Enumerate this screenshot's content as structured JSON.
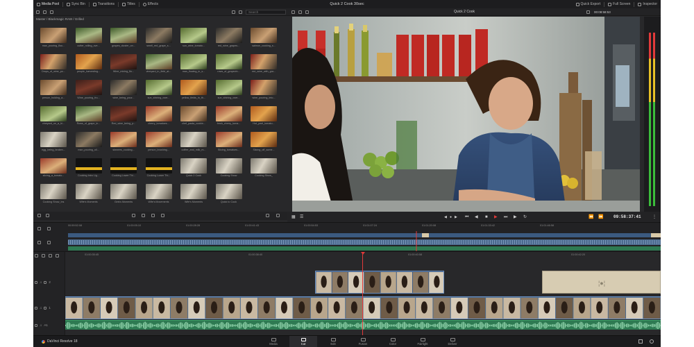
{
  "topbar": {
    "tabs": [
      {
        "label": "Media Pool",
        "icon": "media-pool-icon"
      },
      {
        "label": "Sync Bin",
        "icon": "sync-bin-icon"
      },
      {
        "label": "Transitions",
        "icon": "transitions-icon"
      },
      {
        "label": "Titles",
        "icon": "titles-icon"
      },
      {
        "label": "Effects",
        "icon": "effects-icon"
      }
    ],
    "project_title": "Quick 2 Cook 30sec",
    "right_buttons": [
      {
        "label": "Quick Export",
        "icon": "export-icon"
      },
      {
        "label": "Full Screen",
        "icon": "fullscreen-icon"
      },
      {
        "label": "Inspector",
        "icon": "inspector-icon"
      }
    ]
  },
  "subbar": {
    "search_placeholder": "Search",
    "viewer_name": "Quick 2 Cook",
    "viewer_timecode": "00:08:58:53"
  },
  "media_pool": {
    "breadcrumb": "Master / Blackmagic RAW / Grilled",
    "clips": [
      {
        "name": "man_pouring_flou...",
        "thumb": "t0"
      },
      {
        "name": "cutter_rolling_ove...",
        "thumb": "t1"
      },
      {
        "name": "grapes_cluster_on...",
        "thumb": "t1"
      },
      {
        "name": "smell_red_grape_s...",
        "thumb": "t3"
      },
      {
        "name": "sun_wine_tomato...",
        "thumb": "t4"
      },
      {
        "name": "red_wine_grapes...",
        "thumb": "t3"
      },
      {
        "name": "salmon_cooking_s...",
        "thumb": "t0"
      },
      {
        "name": "Drops_of_wine_po...",
        "thumb": "t2"
      },
      {
        "name": "people_harvesting...",
        "thumb": "t5"
      },
      {
        "name": "Wine_mixing_flo...",
        "thumb": "t6"
      },
      {
        "name": "vineyard_in_field_at...",
        "thumb": "t1"
      },
      {
        "name": "man_flowing_in_s...",
        "thumb": "t4"
      },
      {
        "name": "rows_of_grapevin...",
        "thumb": "t4"
      },
      {
        "name": "red_wine_with_gra...",
        "thumb": "t2"
      },
      {
        "name": "person_holding_a...",
        "thumb": "t0"
      },
      {
        "name": "Wine_pouring_fro...",
        "thumb": "t6"
      },
      {
        "name": "wine_being_pour...",
        "thumb": "t3"
      },
      {
        "name": "sun_shining_over...",
        "thumb": "t4"
      },
      {
        "name": "yellow_fields_in_th...",
        "thumb": "t5"
      },
      {
        "name": "sun_shining_over...",
        "thumb": "t4"
      },
      {
        "name": "wine_pouring_into...",
        "thumb": "t2"
      },
      {
        "name": "vineyard_on_a_hi...",
        "thumb": "t4"
      },
      {
        "name": "Rows_of_grape_in...",
        "thumb": "t1"
      },
      {
        "name": "Red_wine_being_p...",
        "thumb": "t6"
      },
      {
        "name": "cherry_tomatoes...",
        "thumb": "t8"
      },
      {
        "name": "chef_pasta_cookin...",
        "thumb": "t0"
      },
      {
        "name": "fresh_cherry_toma...",
        "thumb": "t8"
      },
      {
        "name": "Hot_peel_tomato...",
        "thumb": "t5"
      },
      {
        "name": "egg_being_broken...",
        "thumb": "t7"
      },
      {
        "name": "man_pouring_oil...",
        "thumb": "t3"
      },
      {
        "name": "skewers_cooking...",
        "thumb": "t8"
      },
      {
        "name": "person_brushing...",
        "thumb": "t8"
      },
      {
        "name": "coffee_and_milk_m...",
        "thumb": "t7"
      },
      {
        "name": "Slicing_tomatoes...",
        "thumb": "t8"
      },
      {
        "name": "Slicing_off_some...",
        "thumb": "t5"
      },
      {
        "name": "slicing_a_tomato...",
        "thumb": "t8"
      },
      {
        "name": "Cooking Intro Lig...",
        "thumb": "tyel"
      },
      {
        "name": "Cooking Lower Thi...",
        "thumb": "tyel"
      },
      {
        "name": "Cooking Lower Thi...",
        "thumb": "tyel"
      },
      {
        "name": "Quick 2 Cook",
        "thumb": "t7"
      },
      {
        "name": "Cooking Show",
        "thumb": "t7"
      },
      {
        "name": "Cooking Show_",
        "thumb": "t7"
      },
      {
        "name": "Cooking Show_Ins",
        "thumb": "t7"
      },
      {
        "name": "Wife's Moments",
        "thumb": "t7"
      },
      {
        "name": "Girls's Moments",
        "thumb": "t7"
      },
      {
        "name": "Wife's Movements",
        "thumb": "t7"
      },
      {
        "name": "Wife's Moments",
        "thumb": "t7"
      },
      {
        "name": "Quick to Cook",
        "thumb": "t7"
      }
    ]
  },
  "viewer": {
    "timecode": "09:58:37:41",
    "controls": [
      "skip-start",
      "step-back",
      "stop",
      "play",
      "step-forward",
      "skip-end",
      "loop"
    ]
  },
  "colors": {
    "accent_red": "#e23a3a",
    "video_clip_blue": "#4b6a8e",
    "audio_clip_green": "#2e7a52",
    "panel_bg": "#28282a"
  },
  "upper_timeline": {
    "ruler": [
      "00:59:52:08",
      "01:00:05:10",
      "01:00:28:28",
      "01:00:41:43",
      "01:00:54:53",
      "01:01:07:24",
      "01:01:20:08",
      "01:01:33:42",
      "01:01:46:58"
    ]
  },
  "lower_timeline": {
    "ruler": [
      "01:00:35:45",
      "01:00:38:40",
      "01:00:40:58",
      "01:00:42:20"
    ],
    "tracks": [
      {
        "label": "2"
      },
      {
        "label": "1"
      },
      {
        "label": "A1"
      }
    ]
  },
  "pagebar": {
    "brand": "DaVinci Resolve 18",
    "pages": [
      {
        "label": "Media",
        "active": false
      },
      {
        "label": "Cut",
        "active": true
      },
      {
        "label": "Edit",
        "active": false
      },
      {
        "label": "Fusion",
        "active": false
      },
      {
        "label": "Color",
        "active": false
      },
      {
        "label": "Fairlight",
        "active": false
      },
      {
        "label": "Deliver",
        "active": false
      }
    ]
  }
}
